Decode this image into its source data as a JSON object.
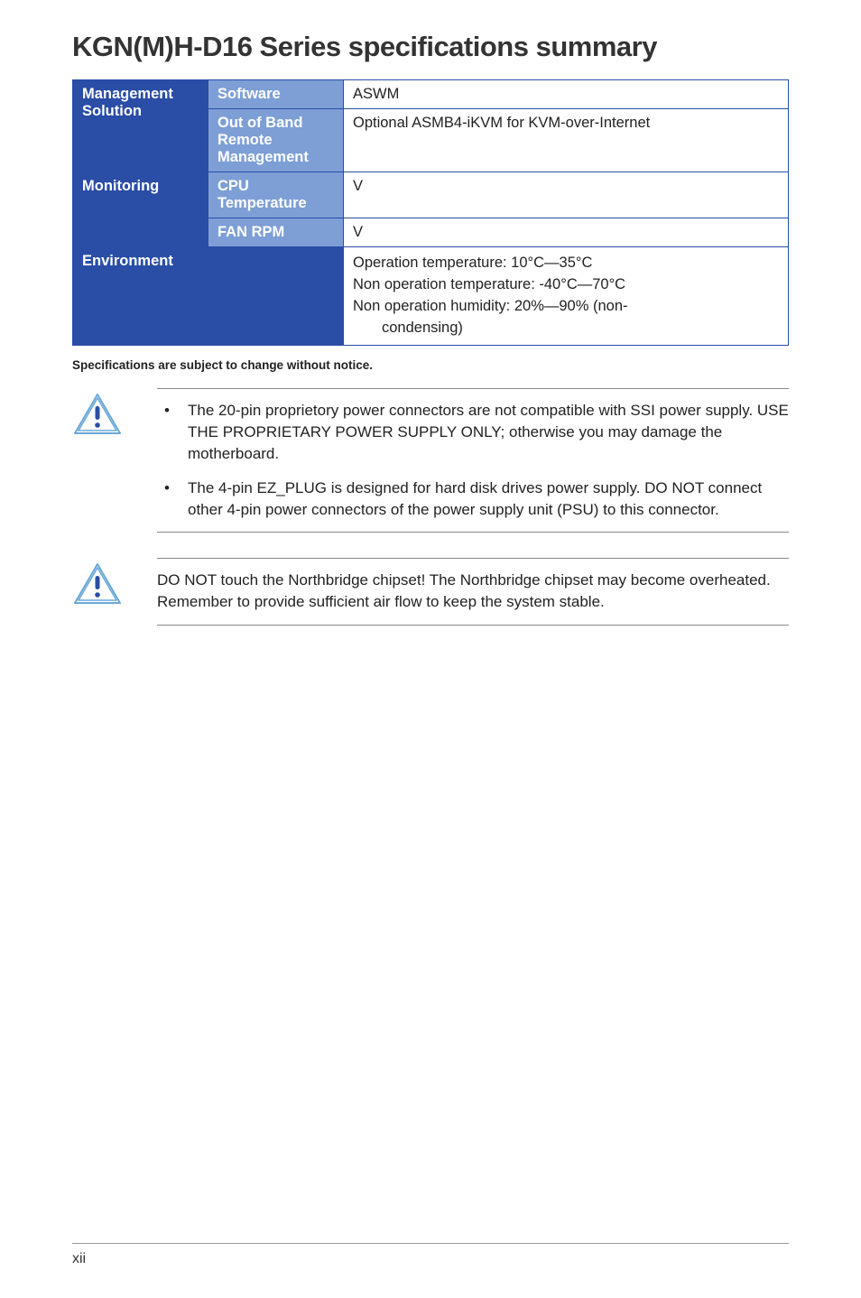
{
  "title": "KGN(M)H-D16 Series specifications summary",
  "table": {
    "mgmt": {
      "header": "Management Solution",
      "row1sub": "Software",
      "row1val": "ASWM",
      "row2sub": "Out of Band Remote Management",
      "row2val": "Optional ASMB4-iKVM for KVM-over-Internet"
    },
    "mon": {
      "header": "Monitoring",
      "row1sub": "CPU Temperature",
      "row1val": "V",
      "row2sub": "FAN RPM",
      "row2val": "V"
    },
    "env": {
      "header": "Environment",
      "line1": "Operation temperature: 10°C—35°C",
      "line2": "Non operation temperature: -40°C—70°C",
      "line3": "Non operation humidity: 20%—90% (non-",
      "line4": "condensing)"
    }
  },
  "spec_note": "Specifications are subject to change without notice.",
  "callout1": {
    "item1": "The 20-pin proprietory power connectors are not compatible with SSI power supply. USE THE PROPRIETARY POWER SUPPLY ONLY; otherwise you may damage the motherboard.",
    "item2": "The 4-pin EZ_PLUG is designed for hard disk drives power supply. DO NOT connect other 4-pin power connectors of the power supply unit (PSU) to this connector."
  },
  "callout2": {
    "text": "DO NOT touch the Northbridge chipset! The Northbridge chipset may become overheated. Remember to provide sufficient air flow to keep the system stable."
  },
  "page_number": "xii"
}
